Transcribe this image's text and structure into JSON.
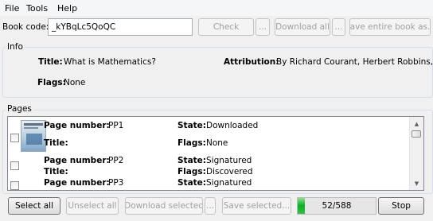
{
  "menu": [
    "File",
    "Tools",
    "Help"
  ],
  "toolbar": {
    "book_code_label": "Book code:",
    "book_code_value": "_kYBqLc5QoQC",
    "check_label": "Check",
    "ellipsis": "...",
    "download_all_label": "Download all",
    "save_book_label": "Save entire book as..."
  },
  "info": {
    "legend": "Info",
    "title_label": "Title:",
    "title_value": "What is Mathematics?",
    "attribution_label": "Attribution:",
    "attribution_value": "By Richard Courant,  Herbert Robbins,  Ia",
    "flags_label": "Flags:",
    "flags_value": "None"
  },
  "pages": {
    "legend": "Pages",
    "field_labels": {
      "page_number": "Page number:",
      "title": "Title:",
      "state": "State:",
      "flags": "Flags:"
    },
    "rows": [
      {
        "page_number": "PP1",
        "title": "",
        "state": "Downloaded",
        "flags": "None",
        "has_thumbnail": true,
        "checked": false
      },
      {
        "page_number": "PP2",
        "title": "",
        "state": "Signatured",
        "flags": "Discovered",
        "has_thumbnail": false,
        "checked": false
      },
      {
        "page_number": "PP3",
        "title": "",
        "state": "Signatured",
        "flags": "",
        "has_thumbnail": false,
        "checked": false
      }
    ]
  },
  "bottom": {
    "select_all_label": "Select all",
    "unselect_all_label": "Unselect all",
    "download_selected_label": "Download selected",
    "ellipsis": "...",
    "save_selected_label": "Save selected...",
    "progress_text": "52/588",
    "progress_fraction": 0.088,
    "stop_label": "Stop"
  }
}
